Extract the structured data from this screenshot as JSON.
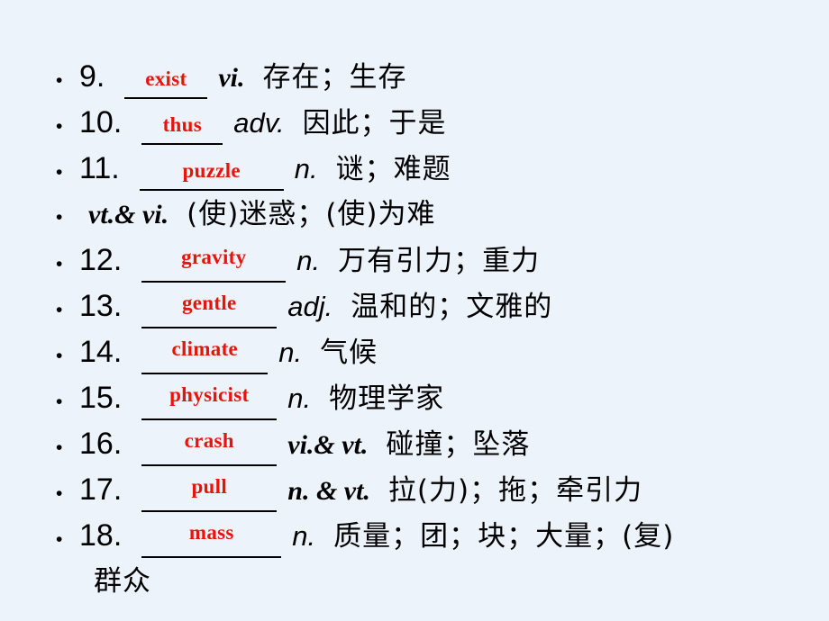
{
  "slide": {
    "background_color": "#edf3fb",
    "answer_color": "#e8140a",
    "text_color": "#000000",
    "bullet_glyph": "•"
  },
  "items": [
    {
      "number": "9.",
      "answer": "exist",
      "blank_width": 92,
      "pos": "vi.",
      "pos_style": "serif",
      "meaning": "存在；生存",
      "high": false
    },
    {
      "number": "10.",
      "answer": "thus",
      "blank_width": 90,
      "pos": "adv.",
      "pos_style": "sans",
      "meaning": "因此；于是",
      "high": false
    },
    {
      "number": "11.",
      "answer": "puzzle",
      "blank_width": 160,
      "pos": "n.",
      "pos_style": "sans",
      "meaning": "谜；难题",
      "high": false
    },
    {
      "number": "",
      "answer": "",
      "blank_width": 0,
      "pos": "vt.& vi.",
      "pos_style": "serif",
      "meaning": "(使)迷惑；(使)为难",
      "high": false,
      "no_number": true
    },
    {
      "number": "12.",
      "answer": "gravity",
      "blank_width": 160,
      "pos": "n.",
      "pos_style": "sans",
      "meaning": "万有引力；重力",
      "high": true
    },
    {
      "number": "13.",
      "answer": "gentle",
      "blank_width": 150,
      "pos": "adj.",
      "pos_style": "sans",
      "meaning": "温和的；文雅的",
      "high": true
    },
    {
      "number": "14.",
      "answer": "climate",
      "blank_width": 140,
      "pos": "n.",
      "pos_style": "sans",
      "meaning": "气候",
      "high": true
    },
    {
      "number": "15.",
      "answer": "physicist",
      "blank_width": 150,
      "pos": "n.",
      "pos_style": "sans",
      "meaning": "物理学家",
      "high": true
    },
    {
      "number": "16.",
      "answer": "crash",
      "blank_width": 150,
      "pos": "vi.& vt.",
      "pos_style": "serif",
      "meaning": "碰撞；坠落",
      "high": true
    },
    {
      "number": "17.",
      "answer": "pull",
      "blank_width": 150,
      "pos": "n. & vt.",
      "pos_style": "mixed",
      "meaning": "拉(力)；拖；牵引力",
      "high": true
    },
    {
      "number": "18.",
      "answer": "mass",
      "blank_width": 155,
      "pos": "n.",
      "pos_style": "sans",
      "meaning": "质量；团；块；大量；(复)",
      "high": true,
      "continuation": "群众"
    }
  ]
}
